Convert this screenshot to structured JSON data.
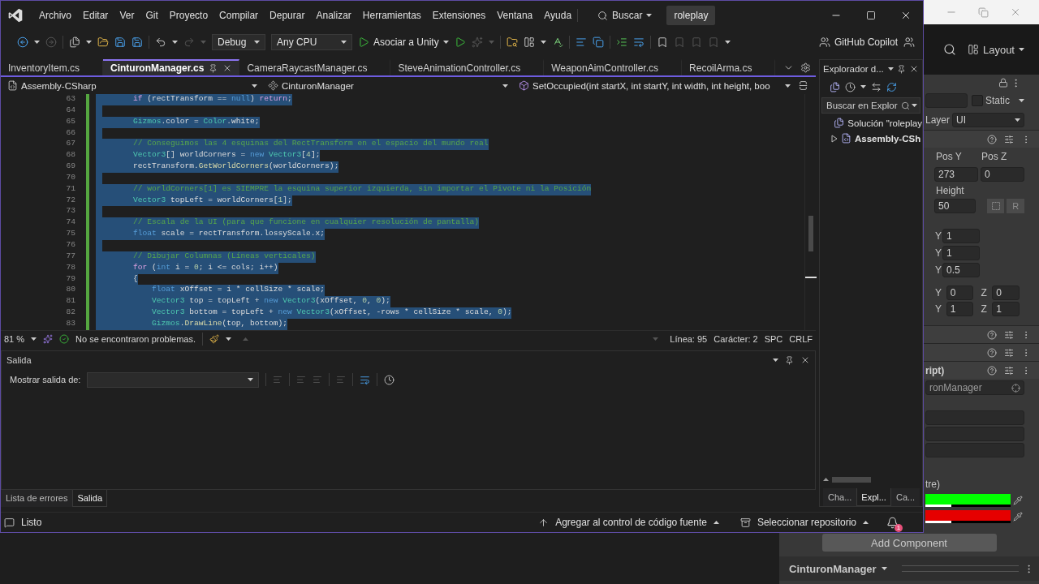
{
  "vs": {
    "menu": [
      "Archivo",
      "Editar",
      "Ver",
      "Git",
      "Proyecto",
      "Compilar",
      "Depurar",
      "Analizar",
      "Herramientas",
      "Extensiones",
      "Ventana",
      "Ayuda"
    ],
    "search": "Buscar",
    "solution_name": "roleplay",
    "toolbar": {
      "configuration": "Debug",
      "platform": "Any CPU",
      "run_target": "Asociar a Unity",
      "copilot": "GitHub Copilot"
    },
    "tabs": [
      {
        "label": "InventoryItem.cs",
        "selected": false
      },
      {
        "label": "CinturonManager.cs",
        "selected": true
      },
      {
        "label": "CameraRaycastManager.cs",
        "selected": false
      },
      {
        "label": "SteveAnimationController.cs",
        "selected": false
      },
      {
        "label": "WeaponAimController.cs",
        "selected": false
      },
      {
        "label": "RecoilArma.cs",
        "selected": false
      }
    ],
    "navigation": {
      "project": "Assembly-CSharp",
      "class": "CinturonManager",
      "member": "SetOccupied(int startX, int startY, int width, int height, boo"
    },
    "code_lines": [
      {
        "number": "63",
        "selected": true,
        "tokens": [
          {
            "kind": "ctl",
            "text": "        if"
          },
          {
            "kind": "t",
            "text": " (rectTransform == "
          },
          {
            "kind": "kw",
            "text": "null"
          },
          {
            "kind": "t",
            "text": ") "
          },
          {
            "kind": "ctl",
            "text": "return"
          },
          {
            "kind": "t",
            "text": ";"
          }
        ]
      },
      {
        "number": "64",
        "selected": true
      },
      {
        "number": "65",
        "selected": true,
        "tokens": [
          {
            "kind": "type",
            "text": "        Gizmos"
          },
          {
            "kind": "t",
            "text": ".color = "
          },
          {
            "kind": "type",
            "text": "Color"
          },
          {
            "kind": "t",
            "text": ".white;"
          }
        ]
      },
      {
        "number": "66",
        "selected": true
      },
      {
        "number": "67",
        "selected": true,
        "tokens": [
          {
            "kind": "cm",
            "text": "        // Conseguimos las 4 esquinas del RectTransform en el espacio del mundo real"
          }
        ]
      },
      {
        "number": "68",
        "selected": true,
        "tokens": [
          {
            "kind": "type",
            "text": "        Vector3"
          },
          {
            "kind": "t",
            "text": "[] worldCorners = "
          },
          {
            "kind": "kw",
            "text": "new"
          },
          {
            "kind": "type",
            "text": " Vector3"
          },
          {
            "kind": "t",
            "text": "["
          },
          {
            "kind": "num",
            "text": "4"
          },
          {
            "kind": "t",
            "text": "];"
          }
        ]
      },
      {
        "number": "69",
        "selected": true,
        "tokens": [
          {
            "kind": "t",
            "text": "        rectTransform."
          },
          {
            "kind": "method",
            "text": "GetWorldCorners"
          },
          {
            "kind": "t",
            "text": "(worldCorners);"
          }
        ]
      },
      {
        "number": "70",
        "selected": true
      },
      {
        "number": "71",
        "selected": true,
        "tokens": [
          {
            "kind": "cm",
            "text": "        // worldCorners[1] es SIEMPRE la esquina superior izquierda, sin importar el Pivote ni la Posición"
          }
        ]
      },
      {
        "number": "72",
        "selected": true,
        "tokens": [
          {
            "kind": "type",
            "text": "        Vector3"
          },
          {
            "kind": "t",
            "text": " topLeft = worldCorners["
          },
          {
            "kind": "num",
            "text": "1"
          },
          {
            "kind": "t",
            "text": "];"
          }
        ]
      },
      {
        "number": "73",
        "selected": true
      },
      {
        "number": "74",
        "selected": true,
        "tokens": [
          {
            "kind": "cm",
            "text": "        // Escala de la UI (para que funcione en cualquier resolución de pantalla)"
          }
        ]
      },
      {
        "number": "75",
        "selected": true,
        "tokens": [
          {
            "kind": "kw",
            "text": "        float"
          },
          {
            "kind": "t",
            "text": " scale = rectTransform.lossyScale.x;"
          }
        ]
      },
      {
        "number": "76",
        "selected": true
      },
      {
        "number": "77",
        "selected": true,
        "tokens": [
          {
            "kind": "cm",
            "text": "        // Dibujar Columnas (Líneas verticales)"
          }
        ]
      },
      {
        "number": "78",
        "selected": true,
        "tokens": [
          {
            "kind": "ctl",
            "text": "        for"
          },
          {
            "kind": "t",
            "text": " ("
          },
          {
            "kind": "kw",
            "text": "int"
          },
          {
            "kind": "t",
            "text": " i = "
          },
          {
            "kind": "num",
            "text": "0"
          },
          {
            "kind": "t",
            "text": "; i <= cols; i++)"
          }
        ]
      },
      {
        "number": "79",
        "selected": true,
        "tokens": [
          {
            "kind": "t",
            "text": "        {"
          }
        ]
      },
      {
        "number": "80",
        "selected": true,
        "tokens": [
          {
            "kind": "kw",
            "text": "            float"
          },
          {
            "kind": "t",
            "text": " xOffset = i * cellSize * scale;"
          }
        ]
      },
      {
        "number": "81",
        "selected": true,
        "tokens": [
          {
            "kind": "type",
            "text": "            Vector3"
          },
          {
            "kind": "t",
            "text": " top = topLeft + "
          },
          {
            "kind": "kw",
            "text": "new"
          },
          {
            "kind": "type",
            "text": " Vector3"
          },
          {
            "kind": "t",
            "text": "(xOffset, "
          },
          {
            "kind": "num",
            "text": "0"
          },
          {
            "kind": "t",
            "text": ", "
          },
          {
            "kind": "num",
            "text": "0"
          },
          {
            "kind": "t",
            "text": ");"
          }
        ]
      },
      {
        "number": "82",
        "selected": true,
        "tokens": [
          {
            "kind": "type",
            "text": "            Vector3"
          },
          {
            "kind": "t",
            "text": " bottom = topLeft + "
          },
          {
            "kind": "kw",
            "text": "new"
          },
          {
            "kind": "type",
            "text": " Vector3"
          },
          {
            "kind": "t",
            "text": "(xOffset, -rows * cellSize * scale, "
          },
          {
            "kind": "num",
            "text": "0"
          },
          {
            "kind": "t",
            "text": ");"
          }
        ]
      },
      {
        "number": "83",
        "selected": true,
        "tokens": [
          {
            "kind": "type",
            "text": "            Gizmos"
          },
          {
            "kind": "t",
            "text": "."
          },
          {
            "kind": "method",
            "text": "DrawLine"
          },
          {
            "kind": "t",
            "text": "(top, bottom);"
          }
        ]
      }
    ],
    "editor_status": {
      "zoom": "81 %",
      "issues": "No se encontraron problemas.",
      "line": "Línea: 95",
      "column": "Carácter: 2",
      "whitespace": "SPC",
      "line_ending": "CRLF"
    },
    "output": {
      "title": "Salida",
      "source_label": "Mostrar salida de:"
    },
    "bottom_tabs": [
      {
        "label": "Lista de errores",
        "selected": false
      },
      {
        "label": "Salida",
        "selected": true
      }
    ],
    "solution_explorer": {
      "title": "Explorador d...",
      "search_placeholder": "Buscar en Explor",
      "tree": [
        {
          "label": "Solución \"roleplay",
          "children": [
            {
              "label": "Assembly-CSh",
              "expanded": false
            }
          ]
        }
      ],
      "tabs": [
        {
          "label": "Cha...",
          "selected": false
        },
        {
          "label": "Expl...",
          "selected": true
        },
        {
          "label": "Ca...",
          "selected": false
        }
      ]
    },
    "status_bar": {
      "state": "Listo",
      "source_control": "Agregar al control de código fuente",
      "repository": "Seleccionar repositorio",
      "notifications": "1"
    }
  },
  "unity": {
    "layout_button": "Layout",
    "inspector": {
      "static": {
        "label": "Static",
        "checked": false
      },
      "layer": {
        "label": "Layer",
        "value": "UI"
      },
      "position": [
        {
          "label": "Pos Y",
          "value": "273"
        },
        {
          "label": "Pos Z",
          "value": "0"
        }
      ],
      "height": {
        "label": "Height",
        "value": "50"
      },
      "raw_button": "R",
      "anchor_rows": [
        {
          "axis": "Y",
          "value": "1"
        },
        {
          "axis": "Y",
          "value": "1"
        },
        {
          "axis": "Y",
          "value": "0.5"
        }
      ],
      "vector_rows": [
        [
          {
            "axis": "Y",
            "value": "0"
          },
          {
            "axis": "Z",
            "value": "0"
          }
        ],
        [
          {
            "axis": "Y",
            "value": "1"
          },
          {
            "axis": "Z",
            "value": "1"
          }
        ]
      ],
      "component_title": "ript)",
      "script_value": "ronManager",
      "color_label": "tre)",
      "color_fields": [
        {
          "color": "#00ff00",
          "level": 0.3
        },
        {
          "color": "#e60000",
          "level": 0.3
        }
      ],
      "add_component": "Add Component"
    },
    "footer_title": "CinturonManager"
  }
}
